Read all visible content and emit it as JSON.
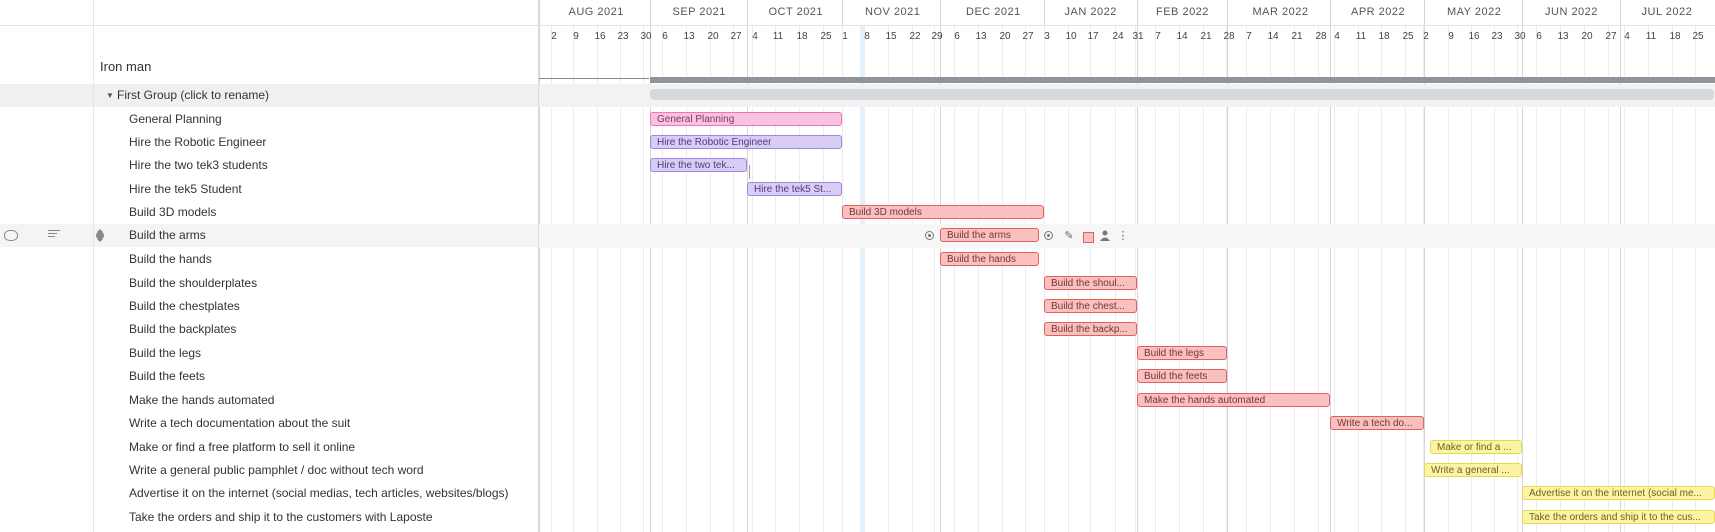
{
  "project": {
    "name": "Iron man"
  },
  "group": {
    "label": "First Group (click to rename)"
  },
  "months": [
    "AUG 2021",
    "SEP 2021",
    "OCT 2021",
    "NOV 2021",
    "DEC 2021",
    "JAN 2022",
    "FEB 2022",
    "MAR 2022",
    "APR 2022",
    "MAY 2022",
    "JUN 2022",
    "JUL 2022"
  ],
  "days": [
    "2",
    "9",
    "16",
    "23",
    "30",
    "6",
    "13",
    "20",
    "27",
    "4",
    "11",
    "18",
    "25",
    "1",
    "8",
    "15",
    "22",
    "29",
    "6",
    "13",
    "20",
    "27",
    "3",
    "10",
    "17",
    "24",
    "31",
    "7",
    "14",
    "21",
    "28",
    "7",
    "14",
    "21",
    "28",
    "4",
    "11",
    "18",
    "25",
    "2",
    "9",
    "16",
    "23",
    "30",
    "6",
    "13",
    "20",
    "27",
    "4",
    "11",
    "18",
    "25"
  ],
  "tasks": [
    {
      "label": "General Planning",
      "bar_label": "General Planning",
      "color": "#f9c2e0"
    },
    {
      "label": "Hire the Robotic Engineer",
      "bar_label": "Hire the Robotic Engineer",
      "color": "#d9cdf6"
    },
    {
      "label": "Hire the two tek3 students",
      "bar_label": "Hire the two tek...",
      "color": "#d9cdf6"
    },
    {
      "label": "Hire the tek5 Student",
      "bar_label": "Hire the tek5 St...",
      "color": "#d9cdf6"
    },
    {
      "label": "Build 3D models",
      "bar_label": "Build 3D models",
      "color": "#f9c0c0"
    },
    {
      "label": "Build the arms",
      "bar_label": "Build the arms",
      "color": "#f9c0c0"
    },
    {
      "label": "Build the hands",
      "bar_label": "Build the hands",
      "color": "#f9c0c0"
    },
    {
      "label": "Build the shoulderplates",
      "bar_label": "Build the shoul...",
      "color": "#f9c0c0"
    },
    {
      "label": "Build the chestplates",
      "bar_label": "Build the chest...",
      "color": "#f9c0c0"
    },
    {
      "label": "Build the backplates",
      "bar_label": "Build the backp...",
      "color": "#f9c0c0"
    },
    {
      "label": "Build the legs",
      "bar_label": "Build the legs",
      "color": "#f9c0c0"
    },
    {
      "label": "Build the feets",
      "bar_label": "Build the feets",
      "color": "#f9c0c0"
    },
    {
      "label": "Make the hands automated",
      "bar_label": "Make the hands automated",
      "color": "#f9c0c0"
    },
    {
      "label": "Write a tech documentation about the suit",
      "bar_label": "Write a tech do...",
      "color": "#f9c0c0"
    },
    {
      "label": "Make or find a free platform to sell it online",
      "bar_label": "Make or find a ...",
      "color": "#fbf4a5"
    },
    {
      "label": "Write a general public pamphlet / doc without tech word",
      "bar_label": "Write a general ...",
      "color": "#fbf4a5"
    },
    {
      "label": "Advertise it on the internet (social medias, tech articles, websites/blogs)",
      "bar_label": "Advertise it on the internet (social me...",
      "color": "#fbf4a5"
    },
    {
      "label": "Take the orders and ship it to the customers with Laposte",
      "bar_label": "Take the orders and ship it to the cus...",
      "color": "#fbf4a5"
    }
  ],
  "icons": {
    "comment": "comment-icon",
    "notes": "notes-icon",
    "drag": "drag-handle-icon",
    "caret": "caret-down-icon",
    "toolbar": [
      "target-icon",
      "pencil-icon",
      "color-swatch-icon",
      "assign-user-icon",
      "more-icon"
    ]
  }
}
